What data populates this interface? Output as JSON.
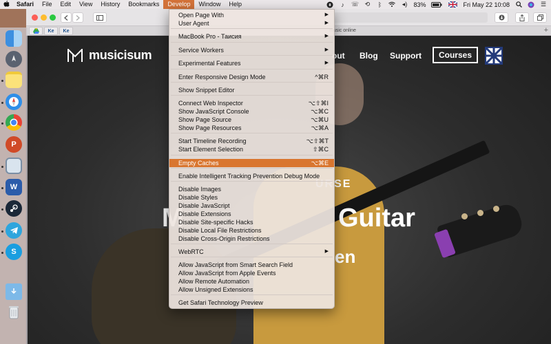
{
  "menubar": {
    "apple": "",
    "items": [
      "Safari",
      "File",
      "Edit",
      "View",
      "History",
      "Bookmarks",
      "Develop",
      "Window",
      "Help"
    ],
    "battery": "83%",
    "datetime": "Fri May 22  10:08",
    "status_icons": [
      "dropbox-icon",
      "music-icon",
      "phone-icon",
      "time-machine-icon",
      "bluetooth-icon",
      "wifi-icon",
      "volume-icon",
      "battery-icon",
      "flag-uk-icon",
      "search-icon",
      "siri-icon",
      "list-icon"
    ]
  },
  "safari": {
    "tabs": [
      "Ke",
      "Ke"
    ],
    "tab_title": "music online",
    "plus": "+"
  },
  "page": {
    "logo": "musicisum",
    "nav": [
      "out",
      "Blog",
      "Support"
    ],
    "courses": "Courses",
    "hero_sub": "URSE",
    "hero_left": "M",
    "hero_right": "Guitar",
    "hero_tail": "en"
  },
  "develop_menu": {
    "items": [
      {
        "label": "Open Page With",
        "shortcut": "",
        "submenu": true
      },
      {
        "label": "User Agent",
        "shortcut": "",
        "submenu": true
      },
      {
        "label": "MacBook Pro - Таисия",
        "shortcut": "",
        "submenu": true
      },
      {
        "label": "Service Workers",
        "shortcut": "",
        "submenu": true
      },
      {
        "label": "Experimental Features",
        "shortcut": "",
        "submenu": true
      },
      {
        "label": "Enter Responsive Design Mode",
        "shortcut": "^⌘R",
        "submenu": false
      },
      {
        "label": "Show Snippet Editor",
        "shortcut": "",
        "submenu": false
      },
      {
        "label": "Connect Web Inspector",
        "shortcut": "⌥⇧⌘I",
        "submenu": false
      },
      {
        "label": "Show JavaScript Console",
        "shortcut": "⌥⌘C",
        "submenu": false
      },
      {
        "label": "Show Page Source",
        "shortcut": "⌥⌘U",
        "submenu": false
      },
      {
        "label": "Show Page Resources",
        "shortcut": "⌥⌘A",
        "submenu": false
      },
      {
        "label": "Start Timeline Recording",
        "shortcut": "⌥⇧⌘T",
        "submenu": false
      },
      {
        "label": "Start Element Selection",
        "shortcut": "⇧⌘C",
        "submenu": false
      },
      {
        "label": "Empty Caches",
        "shortcut": "⌥⌘E",
        "submenu": false,
        "highlighted": true
      },
      {
        "label": "Enable Intelligent Tracking Prevention Debug Mode",
        "shortcut": "",
        "submenu": false
      },
      {
        "label": "Disable Images",
        "shortcut": "",
        "submenu": false
      },
      {
        "label": "Disable Styles",
        "shortcut": "",
        "submenu": false
      },
      {
        "label": "Disable JavaScript",
        "shortcut": "",
        "submenu": false
      },
      {
        "label": "Disable Extensions",
        "shortcut": "",
        "submenu": false
      },
      {
        "label": "Disable Site-specific Hacks",
        "shortcut": "",
        "submenu": false
      },
      {
        "label": "Disable Local File Restrictions",
        "shortcut": "",
        "submenu": false
      },
      {
        "label": "Disable Cross-Origin Restrictions",
        "shortcut": "",
        "submenu": false
      },
      {
        "label": "WebRTC",
        "shortcut": "",
        "submenu": true
      },
      {
        "label": "Allow JavaScript from Smart Search Field",
        "shortcut": "",
        "submenu": false
      },
      {
        "label": "Allow JavaScript from Apple Events",
        "shortcut": "",
        "submenu": false
      },
      {
        "label": "Allow Remote Automation",
        "shortcut": "",
        "submenu": false
      },
      {
        "label": "Allow Unsigned Extensions",
        "shortcut": "",
        "submenu": false
      },
      {
        "label": "Get Safari Technology Preview",
        "shortcut": "",
        "submenu": false
      }
    ]
  },
  "dock": {
    "apps": [
      "finder-icon",
      "launchpad-icon",
      "notes-icon",
      "safari-icon",
      "chrome-icon",
      "powerpoint-icon",
      "preview-icon",
      "word-icon",
      "steam-icon",
      "telegram-icon",
      "skype-icon",
      "downloads-folder-icon",
      "trash-icon"
    ],
    "letters": {
      "powerpoint": "P",
      "word": "W",
      "skype": "S"
    }
  },
  "colors": {
    "menu_highlight": "#d9762f",
    "develop_active": "#d4733a",
    "page_bg": "#2d2d2d",
    "accent_purple": "#8a3fb0"
  }
}
